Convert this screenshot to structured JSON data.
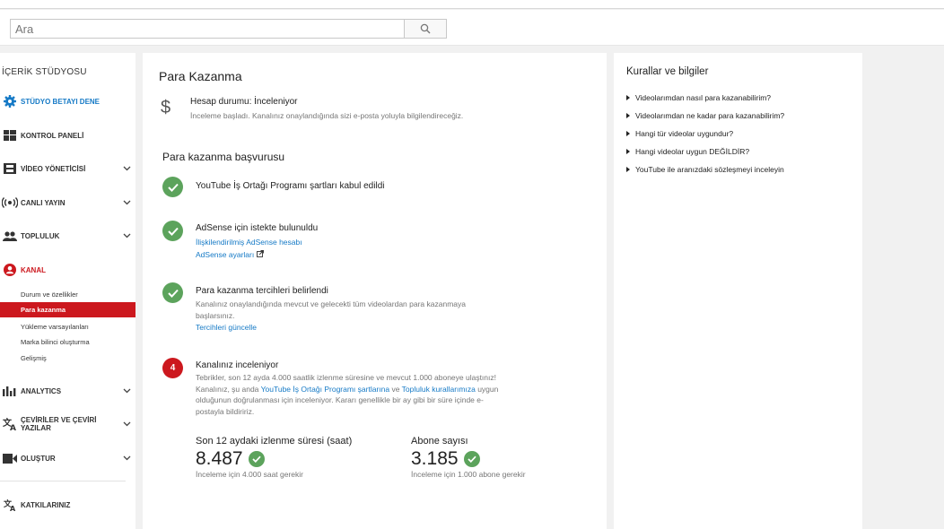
{
  "search": {
    "placeholder": "Ara"
  },
  "sidebar": {
    "title": "İÇERİK STÜDYOSU",
    "items": [
      {
        "label": "STÜDYO BETAYI DENE",
        "icon": "gear-icon"
      },
      {
        "label": "KONTROL PANELİ",
        "icon": "dashboard-icon"
      },
      {
        "label": "VİDEO YÖNETİCİSİ",
        "icon": "video-manager-icon"
      },
      {
        "label": "CANLI YAYIN",
        "icon": "live-broadcast-icon"
      },
      {
        "label": "TOPLULUK",
        "icon": "community-icon"
      },
      {
        "label": "KANAL",
        "icon": "channel-icon"
      },
      {
        "label": "ANALYTICS",
        "icon": "analytics-icon"
      },
      {
        "label": "ÇEVİRİLER VE ÇEVİRİ YAZILAR",
        "icon": "translate-icon"
      },
      {
        "label": "OLUŞTUR",
        "icon": "create-video-icon"
      },
      {
        "label": "KATKILARINIZ",
        "icon": "contributions-icon"
      }
    ],
    "channel_sub": [
      "Durum ve özellikler",
      "Para kazanma",
      "Yükleme varsayılanları",
      "Marka bilinci oluşturma",
      "Gelişmiş"
    ]
  },
  "main": {
    "title": "Para Kazanma",
    "status_title": "Hesap durumu: İnceleniyor",
    "status_desc": "İnceleme başladı. Kanalınız onaylandığında sizi e-posta yoluyla bilgilendireceğiz.",
    "section_title": "Para kazanma başvurusu",
    "step1": {
      "title": "YouTube İş Ortağı Programı şartları kabul edildi"
    },
    "step2": {
      "title": "AdSense için istekte bulunuldu",
      "link1": "İlişkilendirilmiş AdSense hesabı",
      "link2": "AdSense ayarları"
    },
    "step3": {
      "title": "Para kazanma tercihleri belirlendi",
      "body": "Kanalınız onaylandığında mevcut ve gelecekti tüm videolardan para kazanmaya başlarsınız.",
      "link": "Tercihleri güncelle"
    },
    "step4": {
      "number": "4",
      "title": "Kanalınız inceleniyor",
      "body1": "Tebrikler, son 12 ayda 4.000 saatlik izlenme süresine ve mevcut 1.000 aboneye ulaştınız! Kanalınız, şu anda ",
      "link1": "YouTube İş Ortağı Programı şartlarına",
      "body2": " ve ",
      "link2": "Topluluk kurallarımıza",
      "body3": " uygun olduğunun doğrulanması için inceleniyor. Kararı genellikle bir ay gibi bir süre içinde e-postayla bildiririz."
    },
    "watch": {
      "label": "Son 12 aydaki izlenme süresi (saat)",
      "value": "8.487",
      "note": "İnceleme için 4.000 saat gerekir"
    },
    "subs": {
      "label": "Abone sayısı",
      "value": "3.185",
      "note": "İnceleme için 1.000 abone gerekir"
    }
  },
  "right": {
    "title": "Kurallar ve bilgiler",
    "items": [
      "Videolarımdan nasıl para kazanabilirim?",
      "Videolarımdan ne kadar para kazanabilirim?",
      "Hangi tür videolar uygundur?",
      "Hangi videolar uygun DEĞİLDİR?",
      "YouTube ile aranızdaki sözleşmeyi inceleyin"
    ]
  },
  "colors": {
    "accent_red": "#cc181e",
    "link_blue": "#167ac6",
    "success_green": "#5ca35c"
  }
}
